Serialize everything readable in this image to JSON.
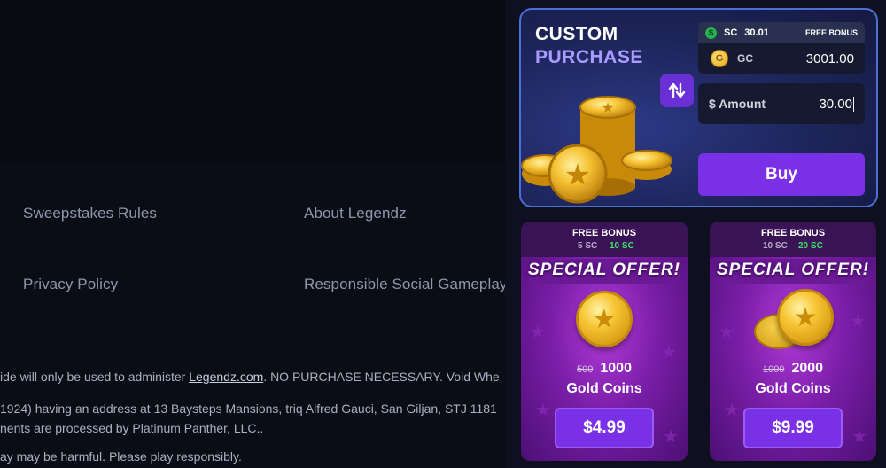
{
  "footer": {
    "links": [
      {
        "label": "Sweepstakes Rules"
      },
      {
        "label": "About Legendz"
      },
      {
        "label": "Privacy Policy"
      },
      {
        "label": "Responsible Social Gameplay"
      }
    ],
    "disclaimer": {
      "line1_prefix": "ide will only be used to administer ",
      "line1_link": "Legendz.com",
      "line1_suffix": ". NO PURCHASE NECESSARY. Void Whe",
      "line2": "1924) having an address at 13 Baysteps Mansions, triq Alfred Gauci, San Giljan, STJ 1181",
      "line3": "nents are processed by Platinum Panther, LLC..",
      "line4": "ay may be harmful. Please play responsibly."
    }
  },
  "custom_purchase": {
    "title_line1": "CUSTOM",
    "title_line2": "PURCHASE",
    "sc_icon": "S",
    "sc_label": "SC",
    "sc_value": "30.01",
    "sc_bonus": "FREE BONUS",
    "gc_icon": "G",
    "gc_label": "GC",
    "gc_value": "3001.00",
    "amount_label": "$ Amount",
    "amount_value": "30.00",
    "buy_label": "Buy",
    "swap_icon": "swap-arrows-icon"
  },
  "offers": [
    {
      "free_bonus_label": "FREE BONUS",
      "old_sc": "5 SC",
      "new_sc": "10 SC",
      "special_label": "SPECIAL OFFER!",
      "old_coins": "500",
      "coins": "1000",
      "gold_label": "Gold Coins",
      "price": "$4.99"
    },
    {
      "free_bonus_label": "FREE BONUS",
      "old_sc": "10 SC",
      "new_sc": "20 SC",
      "special_label": "SPECIAL OFFER!",
      "old_coins": "1000",
      "coins": "2000",
      "gold_label": "Gold Coins",
      "price": "$9.99"
    }
  ],
  "colors": {
    "accent": "#7a30e6",
    "card_border": "#4a6fd6",
    "bonus_green": "#3fe06a"
  }
}
